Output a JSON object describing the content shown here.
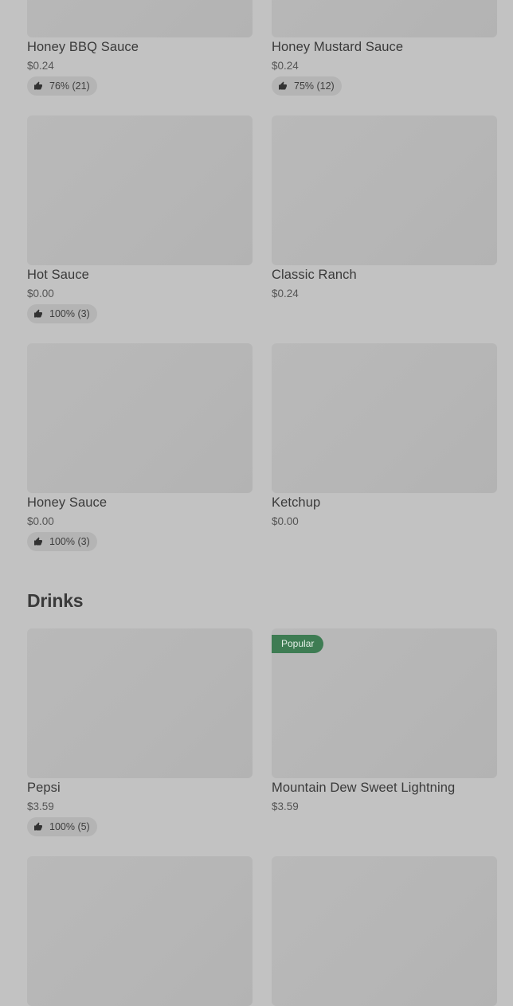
{
  "sauces": [
    {
      "name": "Honey BBQ Sauce",
      "price": "$0.24",
      "rating": "76% (21)"
    },
    {
      "name": "Honey Mustard Sauce",
      "price": "$0.24",
      "rating": "75% (12)"
    },
    {
      "name": "Hot Sauce",
      "price": "$0.00",
      "rating": "100% (3)"
    },
    {
      "name": "Classic Ranch",
      "price": "$0.24",
      "rating": ""
    },
    {
      "name": "Honey Sauce",
      "price": "$0.00",
      "rating": "100% (3)"
    },
    {
      "name": "Ketchup",
      "price": "$0.00",
      "rating": ""
    }
  ],
  "drinks_section": {
    "title": "Drinks",
    "items": [
      {
        "name": "Pepsi",
        "price": "$3.59",
        "rating": "100% (5)",
        "badge": ""
      },
      {
        "name": "Mountain Dew Sweet Lightning",
        "price": "$3.59",
        "rating": "",
        "badge": "Popular"
      }
    ]
  },
  "icons": {
    "rating": "thumbs-up-icon"
  },
  "colors": {
    "background": "#c2c2c2",
    "popular_badge": "#3e7c53"
  }
}
